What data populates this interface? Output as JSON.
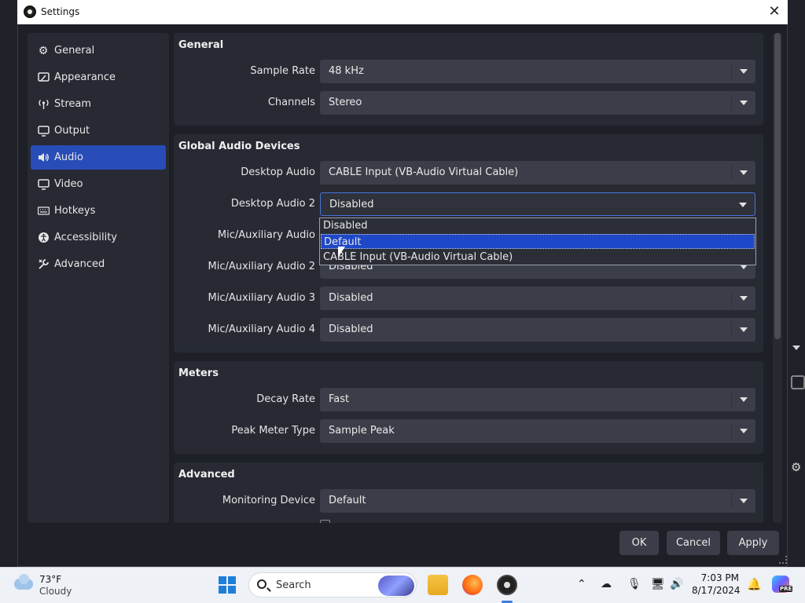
{
  "window": {
    "title": "Settings"
  },
  "sidebar": {
    "items": [
      {
        "label": "General",
        "icon": "gear-icon"
      },
      {
        "label": "Appearance",
        "icon": "appearance-icon"
      },
      {
        "label": "Stream",
        "icon": "stream-icon"
      },
      {
        "label": "Output",
        "icon": "output-icon"
      },
      {
        "label": "Audio",
        "icon": "audio-icon",
        "active": true
      },
      {
        "label": "Video",
        "icon": "video-icon"
      },
      {
        "label": "Hotkeys",
        "icon": "keyboard-icon"
      },
      {
        "label": "Accessibility",
        "icon": "accessibility-icon"
      },
      {
        "label": "Advanced",
        "icon": "wrench-icon"
      }
    ]
  },
  "general": {
    "heading": "General",
    "sample_rate": {
      "label": "Sample Rate",
      "value": "48 kHz"
    },
    "channels": {
      "label": "Channels",
      "value": "Stereo"
    }
  },
  "devices": {
    "heading": "Global Audio Devices",
    "desktop_audio": {
      "label": "Desktop Audio",
      "value": "CABLE Input (VB-Audio Virtual Cable)"
    },
    "desktop_audio_2": {
      "label": "Desktop Audio 2",
      "value": "Disabled"
    },
    "mic_aux": {
      "label": "Mic/Auxiliary Audio",
      "value": ""
    },
    "mic_aux_2": {
      "label": "Mic/Auxiliary Audio 2",
      "value": "Disabled"
    },
    "mic_aux_3": {
      "label": "Mic/Auxiliary Audio 3",
      "value": "Disabled"
    },
    "mic_aux_4": {
      "label": "Mic/Auxiliary Audio 4",
      "value": "Disabled"
    }
  },
  "dropdown": {
    "options": [
      "Disabled",
      "Default",
      "CABLE Input (VB-Audio Virtual Cable)"
    ],
    "selected_index": 1
  },
  "meters": {
    "heading": "Meters",
    "decay_rate": {
      "label": "Decay Rate",
      "value": "Fast"
    },
    "peak_meter_type": {
      "label": "Peak Meter Type",
      "value": "Sample Peak"
    }
  },
  "advanced": {
    "heading": "Advanced",
    "monitoring_device": {
      "label": "Monitoring Device",
      "value": "Default"
    }
  },
  "buttons": {
    "ok": "OK",
    "cancel": "Cancel",
    "apply": "Apply"
  },
  "taskbar": {
    "weather_temp": "73°F",
    "weather_desc": "Cloudy",
    "search_placeholder": "Search",
    "time": "7:03 PM",
    "date": "8/17/2024",
    "copilot_badge": "PRE"
  },
  "colors": {
    "accent": "#284cb8",
    "popup_selection": "#1e48c8",
    "panel": "#272a33",
    "combo": "#3b3e48"
  }
}
